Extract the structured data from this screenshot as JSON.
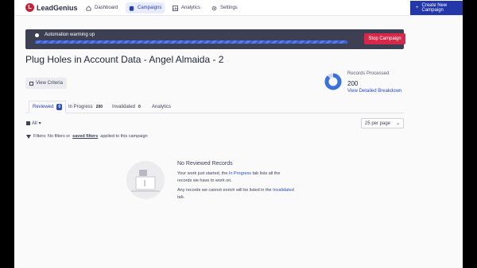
{
  "brand": {
    "name": "LeadGenius",
    "mark": "L"
  },
  "nav": {
    "items": [
      {
        "label": "Dashboard",
        "icon": "home-icon"
      },
      {
        "label": "Campaigns",
        "icon": "database-icon"
      },
      {
        "label": "Analytics",
        "icon": "chart-icon"
      },
      {
        "label": "Settings",
        "icon": "gear-icon"
      }
    ],
    "create_label": "Create New Campaign",
    "create_plus": "+"
  },
  "banner": {
    "text": "Automation warming up",
    "progress": 1.0,
    "stop_label": "Stop Campaign"
  },
  "page_title": "Plug Holes in Account Data - Angel Almaida - 2",
  "criteria_label": "View Criteria",
  "records": {
    "label": "Records Processed",
    "value": "200",
    "link": "View Detailed Breakdown"
  },
  "tabs": [
    {
      "label": "Reviewed",
      "count": "0"
    },
    {
      "label": "In Progress",
      "count": "200"
    },
    {
      "label": "Invalidated",
      "count": "0"
    },
    {
      "label": "Analytics",
      "count": ""
    }
  ],
  "filter": {
    "all_label": "All",
    "caret": "▾"
  },
  "per_page": {
    "value": "25 per page",
    "caret": "⌄"
  },
  "filters_line": {
    "prefix": "Filters: No filters or",
    "link": "saved filters",
    "suffix": "applied to this campaign"
  },
  "empty": {
    "title": "No Reviewed Records",
    "p1_a": "Your work just started, the",
    "p1_link": "In Progress",
    "p1_b": "tab lists all the",
    "p1_c": "records we have to work on.",
    "p2_a": "Any records we cannot enrich will be listed in the",
    "p2_link": "Invalidated",
    "p2_b": "tab."
  },
  "colors": {
    "accent": "#2337a8",
    "stop": "#d6284b",
    "banner": "#3d3f52",
    "brand": "#c4253a"
  }
}
